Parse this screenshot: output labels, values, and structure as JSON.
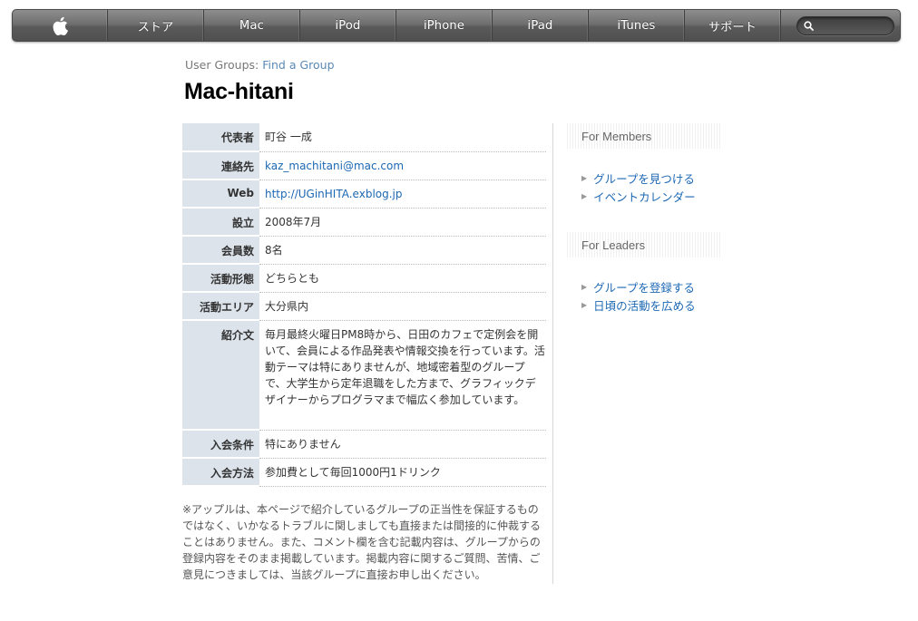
{
  "nav": {
    "apple_icon": "apple-logo-icon",
    "items": [
      "ストア",
      "Mac",
      "iPod",
      "iPhone",
      "iPad",
      "iTunes",
      "サポート"
    ],
    "search_placeholder": ""
  },
  "breadcrumb": {
    "prefix": "User Groups:",
    "link": "Find a Group"
  },
  "title": "Mac-hitani",
  "info": [
    {
      "label": "代表者",
      "value": "町谷 一成"
    },
    {
      "label": "連絡先",
      "value": "kaz_machitani@mac.com"
    },
    {
      "label": "Web",
      "value": "http://UGinHITA.exblog.jp"
    },
    {
      "label": "設立",
      "value": "2008年7月"
    },
    {
      "label": "会員数",
      "value": "8名"
    },
    {
      "label": "活動形態",
      "value": "どちらとも"
    },
    {
      "label": "活動エリア",
      "value": "大分県内"
    },
    {
      "label": "紹介文",
      "value": "毎月最終火曜日PM8時から、日田のカフェで定例会を開いて、会員による作品発表や情報交換を行っています。活動テーマは特にありませんが、地域密着型のグループで、大学生から定年退職をした方まで、グラフィックデザイナーからプログラマまで幅広く参加しています。"
    },
    {
      "label": "入会条件",
      "value": "特にありません"
    },
    {
      "label": "入会方法",
      "value": "参加費として毎回1000円1ドリンク"
    }
  ],
  "disclaimer": "※アップルは、本ページで紹介しているグループの正当性を保証するものではなく、いかなるトラブルに関しましても直接または間接的に仲裁することはありません。また、コメント欄を含む記載内容は、グループからの登録内容をそのまま掲載しています。掲載内容に関するご質問、苦情、ご意見につきましては、当該グループに直接お申し出ください。",
  "sidebar": {
    "members": {
      "heading": "For Members",
      "links": [
        "グループを見つける",
        "イベントカレンダー"
      ]
    },
    "leaders": {
      "heading": "For Leaders",
      "links": [
        "グループを登録する",
        "日頃の活動を広める"
      ]
    }
  }
}
